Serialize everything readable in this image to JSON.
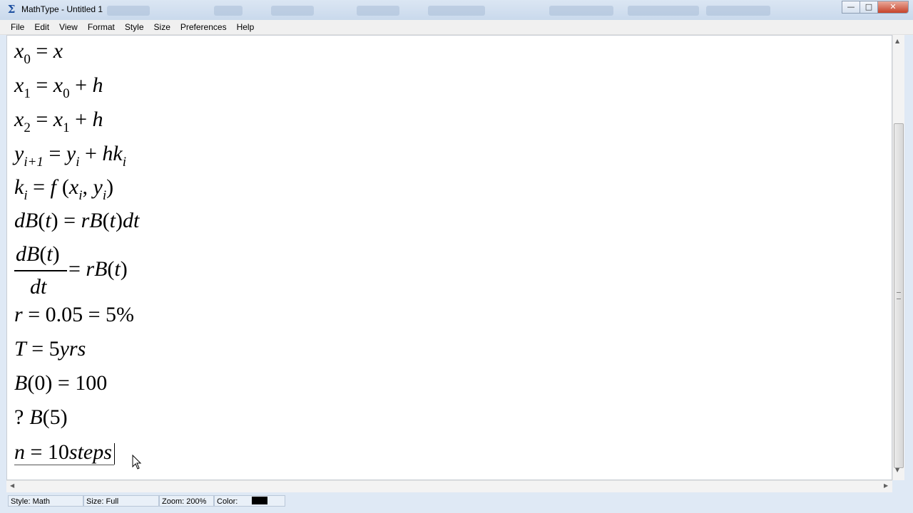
{
  "window": {
    "title": "MathType - Untitled 1",
    "controls": {
      "minimize": "—",
      "maximize": "□",
      "close": "✕"
    }
  },
  "menu": [
    "File",
    "Edit",
    "View",
    "Format",
    "Style",
    "Size",
    "Preferences",
    "Help"
  ],
  "document": {
    "equations": [
      {
        "id": "x0",
        "text": "x0 = x"
      },
      {
        "id": "x1",
        "text": "x1 = x0 + h"
      },
      {
        "id": "x2",
        "text": "x2 = x1 + h"
      },
      {
        "id": "yi1",
        "text": "yi+1 = yi + hki"
      },
      {
        "id": "ki",
        "text": "ki = f (xi , yi)"
      },
      {
        "id": "dB",
        "text": "dB(t) = rB(t)dt"
      },
      {
        "id": "deriv",
        "text": "dB(t)/dt = rB(t)"
      },
      {
        "id": "rate",
        "text": "r = 0.05 = 5%"
      },
      {
        "id": "T",
        "text": "T = 5yrs"
      },
      {
        "id": "B0",
        "text": "B(0) = 100"
      },
      {
        "id": "B5",
        "text": "? B(5)"
      },
      {
        "id": "n",
        "text": "n = 10steps"
      }
    ],
    "parts": {
      "x0": {
        "a": "x",
        "a_sub": "0",
        "eq": " = ",
        "b": "x"
      },
      "x1": {
        "a": "x",
        "a_sub": "1",
        "eq": " = ",
        "b": "x",
        "b_sub": "0",
        "plus": " + ",
        "c": "h"
      },
      "x2": {
        "a": "x",
        "a_sub": "2",
        "eq": " = ",
        "b": "x",
        "b_sub": "1",
        "plus": " + ",
        "c": "h"
      },
      "yi1": {
        "a": "y",
        "a_sub": "i+1",
        "eq": " = ",
        "b": "y",
        "b_sub": "i",
        "plus": " + ",
        "c": "hk",
        "c_sub": "i"
      },
      "ki": {
        "a": "k",
        "a_sub": "i",
        "eq": " = ",
        "f": "f",
        "lp": "(",
        "x": "x",
        "x_sub": "i",
        "comma": ", ",
        "y": "y",
        "y_sub": "i",
        "rp": ")"
      },
      "dB": {
        "lhs": "dB",
        "lp1": "(",
        "t1": "t",
        "rp1": ")",
        "eq": " = ",
        "r": "rB",
        "lp2": "(",
        "t2": "t",
        "rp2": ")",
        "dt": "dt"
      },
      "deriv": {
        "num": "dB",
        "num_lp": "(",
        "num_t": "t",
        "num_rp": ")",
        "den": "dt",
        "eq": " = ",
        "r": "rB",
        "lp": "(",
        "t": "t",
        "rp": ")"
      },
      "rate": {
        "r": "r",
        "eq1": " = ",
        "v1": "0.05",
        "eq2": " = ",
        "v2": "5%"
      },
      "T": {
        "T": "T",
        "eq": " = ",
        "v": "5",
        "u": "yrs"
      },
      "B0": {
        "B": "B",
        "lp": "(",
        "z": "0",
        "rp": ")",
        "eq": " = ",
        "v": "100"
      },
      "B5": {
        "q": "?",
        "B": "B",
        "lp": "(",
        "v": "5",
        "rp": ")"
      },
      "n": {
        "n": "n",
        "eq": " = ",
        "v": "10",
        "u": "steps"
      }
    }
  },
  "status": {
    "style": "Style: Math",
    "size": "Size: Full",
    "zoom": "Zoom: 200%",
    "color_label": "Color:",
    "color_value": "#000000"
  }
}
